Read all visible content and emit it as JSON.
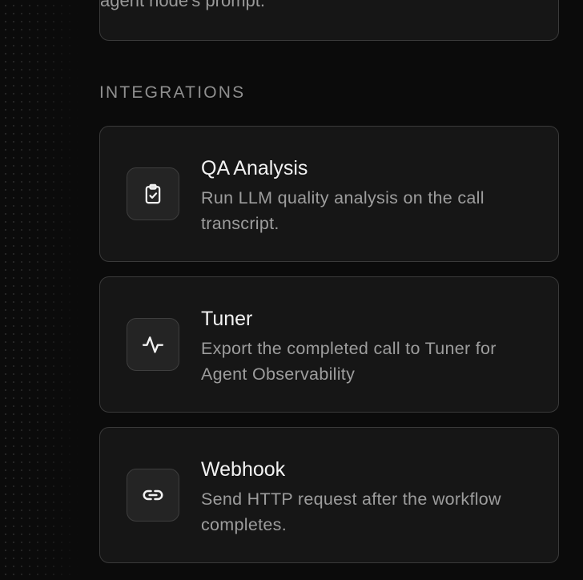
{
  "top_card": {
    "text": "agent node's prompt."
  },
  "section": {
    "heading": "INTEGRATIONS"
  },
  "integrations": [
    {
      "title": "QA Analysis",
      "description": "Run LLM quality analysis on the call transcript.",
      "icon": "clipboard-check-icon"
    },
    {
      "title": "Tuner",
      "description": "Export the completed call to Tuner for Agent Observability",
      "icon": "activity-icon"
    },
    {
      "title": "Webhook",
      "description": "Send HTTP request after the workflow completes.",
      "icon": "link-icon"
    }
  ]
}
